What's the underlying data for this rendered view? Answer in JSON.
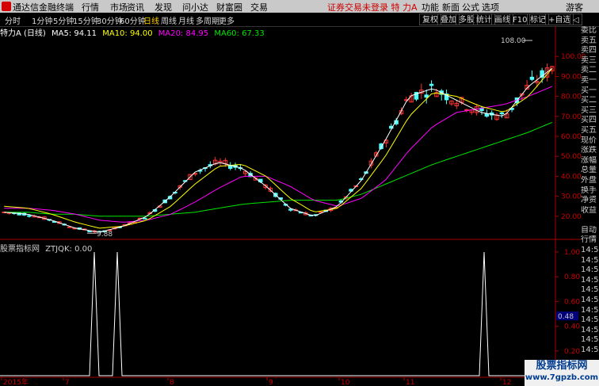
{
  "menu": {
    "app_title": "通达信金融终端",
    "items": [
      "行情",
      "市场",
      "资讯",
      "发现",
      "问小达",
      "财富圈",
      "交易"
    ],
    "warning": "证券交易未登录",
    "stock": "特 力A",
    "right_items": [
      "功能",
      "新面",
      "公式",
      "选项"
    ],
    "guest": "游客"
  },
  "toolbar": {
    "periods": [
      "分时",
      "1分钟",
      "5分钟",
      "15分钟",
      "30分钟",
      "60分钟",
      "日线",
      "周线",
      "月线",
      "多周期",
      "更多"
    ],
    "selected": "日线",
    "buttons": [
      "复权",
      "叠加",
      "多股",
      "统计",
      "画线",
      "F10",
      "标记",
      "+自选",
      "◁"
    ]
  },
  "ma_line": {
    "name": "特力A (日线)",
    "ma5": "MA5: 94.11",
    "ma10": "MA10: 94.00",
    "ma20": "MA20: 84.95",
    "ma60": "MA60: 67.33"
  },
  "price_axis": [
    "100.00",
    "90.00",
    "80.00",
    "70.00",
    "60.00",
    "50.00",
    "40.00",
    "30.00",
    "20.00"
  ],
  "annotations": {
    "high": "108.00",
    "low": "9.88"
  },
  "indicator": {
    "label": "股票指标网",
    "name": "ZTJQK: 0.00",
    "axis": [
      "1.00",
      "0.80",
      "0.60",
      "0.40",
      "0.20"
    ],
    "marker": "0.48"
  },
  "date_axis": [
    "2015年",
    "7",
    "8",
    "9",
    "10",
    "11",
    "12"
  ],
  "side_panel": [
    "委比",
    "卖五",
    "卖四",
    "卖三",
    "卖二",
    "卖一",
    "买一",
    "买二",
    "买三",
    "买四",
    "买五",
    "现价",
    "涨跌",
    "涨幅",
    "总量",
    "外盘",
    "换手",
    "净资",
    "收益",
    "",
    "自动",
    "行情",
    "14:50",
    "14:50",
    "14:50",
    "14:50",
    "14:50",
    "14:50",
    "14:50",
    "14:50",
    "14:50",
    "14:50",
    "14:50"
  ],
  "watermark": {
    "line1": "股票指标网",
    "line2": "www.7gpzb.com"
  },
  "colors": {
    "up": "#ff3232",
    "down": "#54ffff",
    "ma5": "#ffffff",
    "ma10": "#ffff00",
    "ma20": "#ff00ff",
    "ma60": "#00e600"
  },
  "chart_data": {
    "type": "candlestick",
    "ma": {
      "ma5": [
        22,
        21,
        18,
        14,
        12,
        15,
        20,
        30,
        42,
        47,
        44,
        35,
        24,
        20,
        25,
        38,
        58,
        80,
        84,
        78,
        72,
        70,
        85,
        94
      ],
      "ma10": [
        25,
        24,
        21,
        17,
        14,
        15,
        18,
        25,
        36,
        45,
        46,
        40,
        29,
        22,
        24,
        34,
        50,
        70,
        82,
        80,
        75,
        72,
        80,
        94
      ],
      "ma20": [
        24,
        24,
        23,
        21,
        18,
        17,
        18,
        21,
        27,
        34,
        40,
        40,
        35,
        28,
        25,
        29,
        38,
        53,
        65,
        72,
        74,
        76,
        80,
        85
      ],
      "ma60": [
        22,
        22,
        21,
        21,
        20,
        20,
        20,
        21,
        22,
        24,
        26,
        27,
        28,
        28,
        28,
        31,
        36,
        41,
        46,
        50,
        54,
        58,
        62,
        67
      ]
    },
    "signals": [
      {
        "date": "2015-07-14",
        "value": 1
      },
      {
        "date": "2015-07-23",
        "value": 1
      },
      {
        "date": "2015-12-01",
        "value": 1
      }
    ]
  }
}
